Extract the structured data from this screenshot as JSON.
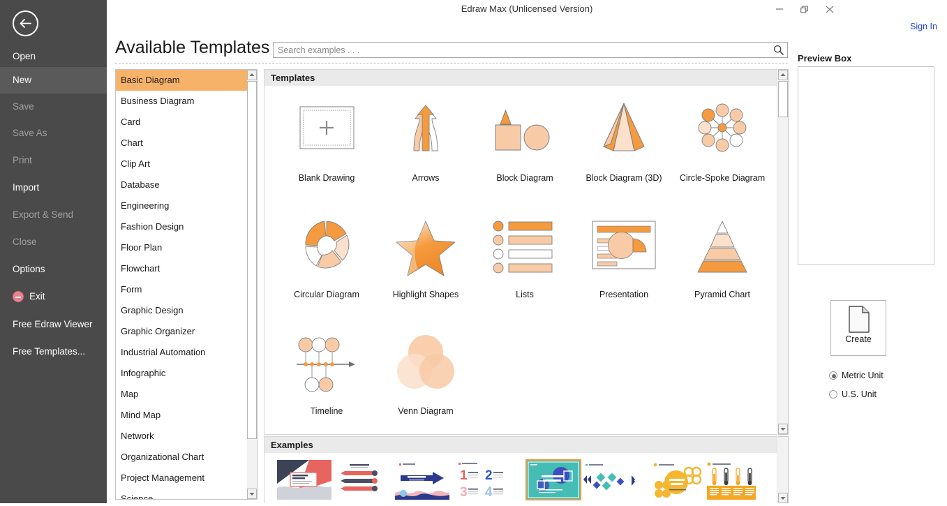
{
  "window": {
    "title": "Edraw Max (Unlicensed Version)",
    "minimize_label": "Minimize",
    "maximize_label": "Restore",
    "close_label": "Close",
    "sign_in_label": "Sign In"
  },
  "backstage": {
    "back_label": "Back",
    "items": [
      {
        "label": "Open",
        "state": "normal",
        "icon": "none"
      },
      {
        "label": "New",
        "state": "active",
        "icon": "none"
      },
      {
        "label": "Save",
        "state": "disabled",
        "icon": "none"
      },
      {
        "label": "Save As",
        "state": "disabled",
        "icon": "none"
      },
      {
        "label": "Print",
        "state": "disabled",
        "icon": "none"
      },
      {
        "label": "Import",
        "state": "normal",
        "icon": "none"
      },
      {
        "label": "Export & Send",
        "state": "disabled",
        "icon": "none"
      },
      {
        "label": "Close",
        "state": "disabled",
        "icon": "none"
      },
      {
        "label": "Options",
        "state": "normal",
        "icon": "none"
      },
      {
        "label": "Exit",
        "state": "normal",
        "icon": "exit-icon"
      },
      {
        "label": "Free Edraw Viewer",
        "state": "normal",
        "icon": "none"
      },
      {
        "label": "Free Templates...",
        "state": "normal",
        "icon": "none"
      }
    ]
  },
  "header": {
    "page_title": "Available Templates"
  },
  "search": {
    "placeholder": "Search examples . . .",
    "value": "",
    "icon": "search-icon"
  },
  "categories": {
    "selected": "Basic Diagram",
    "items": [
      "Basic Diagram",
      "Business Diagram",
      "Card",
      "Chart",
      "Clip Art",
      "Database",
      "Engineering",
      "Fashion Design",
      "Floor Plan",
      "Flowchart",
      "Form",
      "Graphic Design",
      "Graphic Organizer",
      "Industrial Automation",
      "Infographic",
      "Map",
      "Mind Map",
      "Network",
      "Organizational Chart",
      "Project Management",
      "Science"
    ]
  },
  "templates": {
    "section_label": "Templates",
    "items": [
      {
        "label": "Blank Drawing",
        "thumb": "blank-drawing-thumb"
      },
      {
        "label": "Arrows",
        "thumb": "arrows-thumb"
      },
      {
        "label": "Block Diagram",
        "thumb": "block-diagram-thumb"
      },
      {
        "label": "Block Diagram (3D)",
        "thumb": "block-diagram-3d-thumb"
      },
      {
        "label": "Circle-Spoke Diagram",
        "thumb": "circle-spoke-thumb"
      },
      {
        "label": "Circular Diagram",
        "thumb": "circular-diagram-thumb"
      },
      {
        "label": "Highlight Shapes",
        "thumb": "highlight-shapes-thumb"
      },
      {
        "label": "Lists",
        "thumb": "lists-thumb"
      },
      {
        "label": "Presentation",
        "thumb": "presentation-thumb"
      },
      {
        "label": "Pyramid Chart",
        "thumb": "pyramid-chart-thumb"
      },
      {
        "label": "Timeline",
        "thumb": "timeline-thumb"
      },
      {
        "label": "Venn Diagram",
        "thumb": "venn-diagram-thumb"
      }
    ]
  },
  "examples": {
    "section_label": "Examples",
    "items": [
      {
        "thumb": "example-title-slide",
        "title_text": "Add Your Title Here",
        "selected": false
      },
      {
        "thumb": "example-pencil-list",
        "title_text": "Add Your Title Here",
        "selected": false
      },
      {
        "thumb": "example-arrow-banner",
        "title_text": "Add Your Title Here",
        "selected": false
      },
      {
        "thumb": "example-numbered-grid",
        "title_text": "",
        "selected": false
      },
      {
        "thumb": "example-teal-cover",
        "title_text": "Add Your Title Here",
        "selected": true
      },
      {
        "thumb": "example-diamond-chain",
        "title_text": "",
        "selected": false
      },
      {
        "thumb": "example-flower-circle",
        "title_text": "Add Your Title Here",
        "selected": false
      },
      {
        "thumb": "example-thermometers",
        "title_text": "Add Your Title Here",
        "selected": false
      }
    ]
  },
  "preview": {
    "title": "Preview Box",
    "content": ""
  },
  "actions": {
    "create_label": "Create",
    "create_icon": "document-icon",
    "units": [
      {
        "label": "Metric Unit",
        "selected": true
      },
      {
        "label": "U.S. Unit",
        "selected": false
      }
    ]
  },
  "colors": {
    "accent_orange": "#f59a3e",
    "accent_light": "#f8cba6",
    "accent_pale": "#fbe0cb",
    "selected_row": "#f7b26a",
    "sidebar_bg": "#4a4a4a",
    "sidebar_active": "#5a5a5a",
    "section_head_bg": "#eaeaea",
    "link_blue": "#1c44d6"
  }
}
